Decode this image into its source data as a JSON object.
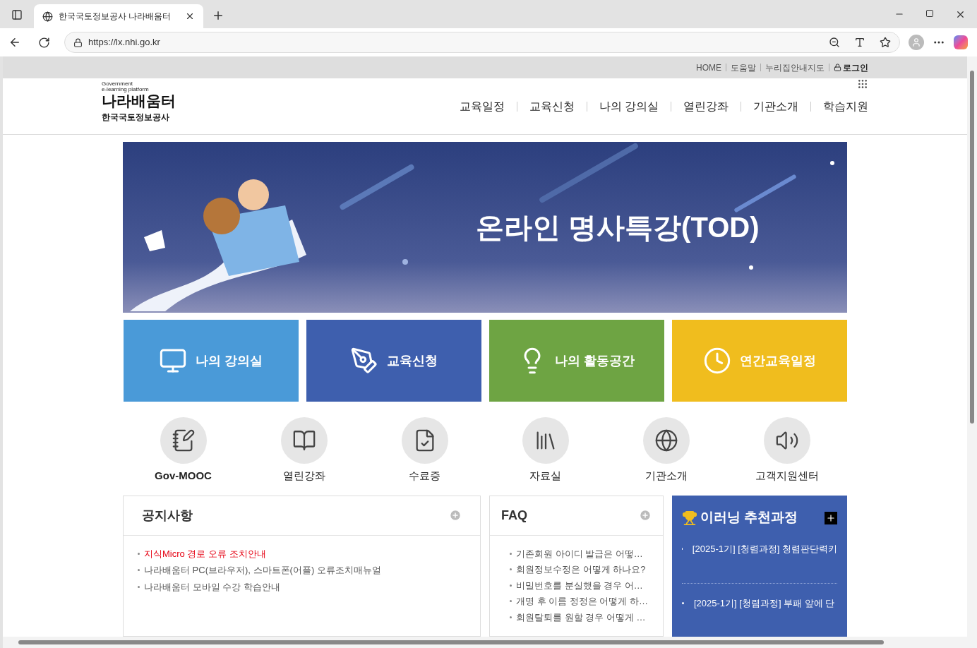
{
  "browser": {
    "tab_title": "한국국토정보공사 나라배움터",
    "url": "https://lx.nhi.go.kr"
  },
  "util_links": [
    "HOME",
    "도움말",
    "누리집안내지도"
  ],
  "login": "로그인",
  "logo": {
    "line1": "Government",
    "line2": "e-learning platform",
    "name": "나라배움터",
    "org": "한국국토정보공사"
  },
  "nav": [
    "교육일정",
    "교육신청",
    "나의 강의실",
    "열린강좌",
    "기관소개",
    "학습지원"
  ],
  "banner": {
    "title": "온라인 명사특강(TOD)"
  },
  "tiles": [
    {
      "label": "나의 강의실",
      "color": "#4a9ad8",
      "kind": "monitor"
    },
    {
      "label": "교육신청",
      "color": "#3e5fae",
      "kind": "pen"
    },
    {
      "label": "나의 활동공간",
      "color": "#6ea443",
      "kind": "bulb"
    },
    {
      "label": "연간교육일정",
      "color": "#f0bd1e",
      "kind": "clock"
    }
  ],
  "quick_links": [
    {
      "label": "Gov-MOOC",
      "kind": "notebook"
    },
    {
      "label": "열린강좌",
      "kind": "book"
    },
    {
      "label": "수료증",
      "kind": "certificate"
    },
    {
      "label": "자료실",
      "kind": "binders"
    },
    {
      "label": "기관소개",
      "kind": "globe"
    },
    {
      "label": "고객지원센터",
      "kind": "speaker"
    }
  ],
  "notices": {
    "title": "공지사항",
    "items": [
      {
        "text": "지식Micro 경로 오류 조치안내",
        "highlighted": true
      },
      {
        "text": "나라배움터 PC(브라우저), 스마트폰(어플) 오류조치매뉴얼",
        "highlighted": false
      },
      {
        "text": "나라배움터 모바일 수강 학습안내",
        "highlighted": false
      }
    ]
  },
  "faq": {
    "title": "FAQ",
    "items": [
      "기존회원 아이디 발급은 어떻…",
      "회원정보수정은 어떻게 하나요?",
      "비밀번호를 분실했을 경우 어…",
      "개명 후 이름 정정은 어떻게 하…",
      "회원탈퇴를 원할 경우 어떻게 …"
    ]
  },
  "recommended": {
    "title": "이러닝 추천과정",
    "items": [
      "[2025-1기] [청렴과정] 청렴판단력키",
      "[2025-1기] [청렴과정] 부패 앞에 단"
    ]
  }
}
